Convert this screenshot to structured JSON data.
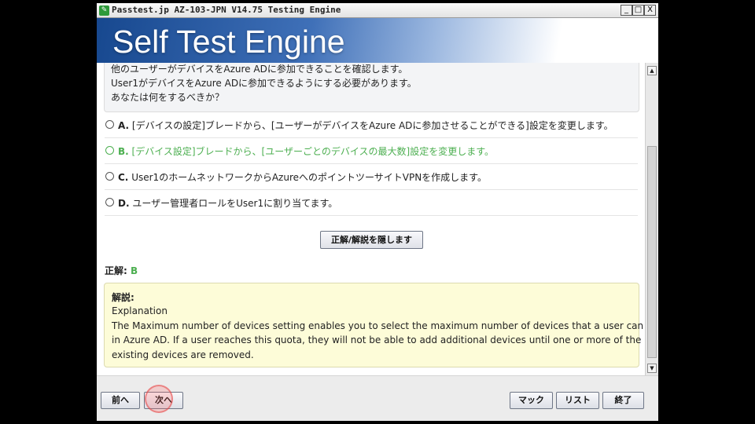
{
  "window": {
    "title": "Passtest.jp AZ-103-JPN V14.75 Testing Engine",
    "buttons": {
      "minimize": "_",
      "maximize": "□",
      "close": "X"
    }
  },
  "banner": {
    "title": "Self Test Engine"
  },
  "question": {
    "lines": [
      "他のユーザーがデバイスをAzure ADに参加できることを確認します。",
      "User1がデバイスをAzure ADに参加できるようにする必要があります。",
      "あなたは何をするべきか？"
    ]
  },
  "options": [
    {
      "letter": "A.",
      "text": "[デバイスの設定]ブレードから、[ユーザーがデバイスをAzure ADに参加させることができる]設定を変更します。",
      "correct": false
    },
    {
      "letter": "B.",
      "text": "[デバイス設定]ブレードから、[ユーザーごとのデバイスの最大数]設定を変更します。",
      "correct": true
    },
    {
      "letter": "C.",
      "text": "User1のホームネットワークからAzureへのポイントツーサイトVPNを作成します。",
      "correct": false
    },
    {
      "letter": "D.",
      "text": "ユーザー管理者ロールをUser1に割り当てます。",
      "correct": false
    }
  ],
  "toggle_button": "正解/解説を隠します",
  "answer": {
    "label": "正解:",
    "value": "B"
  },
  "explanation": {
    "heading": "解説:",
    "lines": [
      "Explanation",
      "The Maximum number of devices setting enables you to select the maximum number of devices that a user can have",
      "in Azure AD. If a user reaches this quota, they will not be able to add additional devices until one or more of the",
      "existing devices are removed."
    ]
  },
  "scrollbar": {
    "up_icon": "▲",
    "down_icon": "▼"
  },
  "footer": {
    "prev": "前へ",
    "next": "次へ",
    "mark": "マック",
    "list": "リスト",
    "end": "終了"
  },
  "colors": {
    "correct": "#4caf50",
    "banner": "#17488f",
    "explanation_bg": "#fdfcd8"
  }
}
